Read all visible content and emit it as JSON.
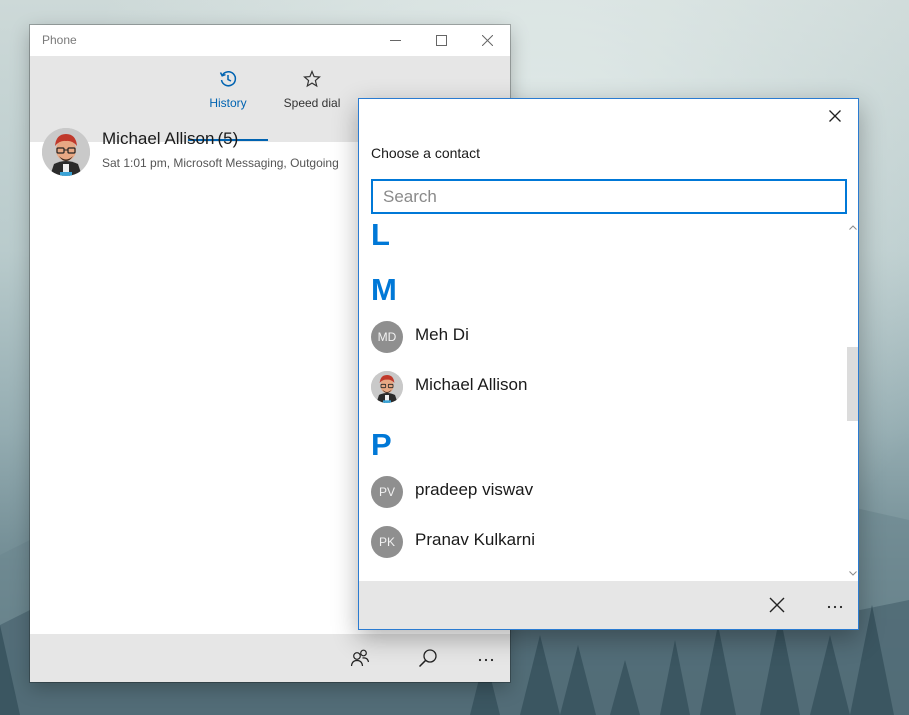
{
  "phone_window": {
    "title": "Phone",
    "tabs": [
      {
        "label": "History",
        "icon": "history-icon",
        "active": true
      },
      {
        "label": "Speed dial",
        "icon": "star-icon",
        "active": false
      }
    ],
    "history": [
      {
        "name": "Michael Allison",
        "count": "(5)",
        "detail": "Sat 1:01 pm, Microsoft Messaging, Outgoing"
      }
    ],
    "command_bar": [
      "contacts-icon",
      "search-icon",
      "more-icon"
    ]
  },
  "dialog": {
    "heading": "Choose a contact",
    "search_placeholder": "Search",
    "search_value": "",
    "groups": [
      {
        "letter": "L",
        "contacts": []
      },
      {
        "letter": "M",
        "contacts": [
          {
            "name": "Meh Di",
            "initials": "MD",
            "has_photo": false
          },
          {
            "name": "Michael Allison",
            "initials": "",
            "has_photo": true
          }
        ]
      },
      {
        "letter": "P",
        "contacts": [
          {
            "name": "pradeep viswav",
            "initials": "PV",
            "has_photo": false
          },
          {
            "name": "Pranav Kulkarni",
            "initials": "PK",
            "has_photo": false
          }
        ]
      }
    ],
    "command_bar": [
      "close-icon",
      "more-icon"
    ]
  },
  "colors": {
    "accent": "#0078d7",
    "active_tab": "#0063b1",
    "command_bar_bg": "#e6e6e6",
    "initials_avatar_bg": "#8f8f8f"
  }
}
